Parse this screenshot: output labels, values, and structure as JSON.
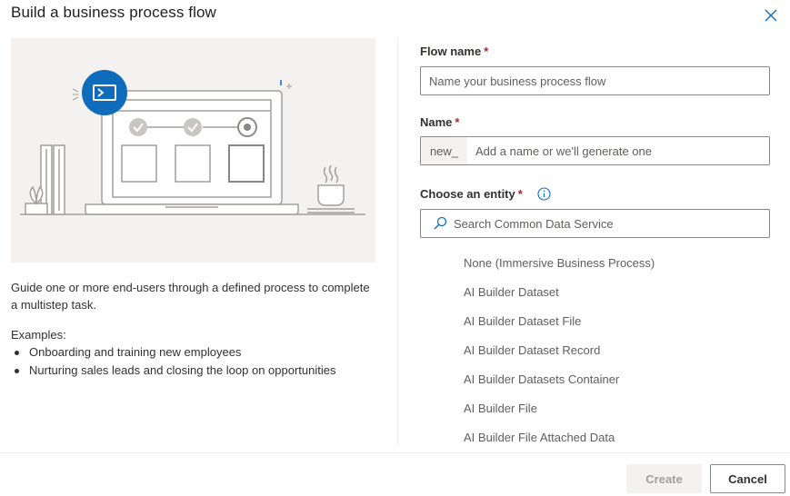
{
  "dialog": {
    "title": "Build a business process flow",
    "close_icon": "close-icon"
  },
  "left": {
    "illustration_icon": "flow-terminal-icon",
    "description": "Guide one or more end-users through a defined process to complete a multistep task.",
    "examples_label": "Examples:",
    "examples": [
      "Onboarding and training new employees",
      "Nurturing sales leads and closing the loop on opportunities"
    ]
  },
  "form": {
    "flow_name": {
      "label": "Flow name",
      "required_marker": "*",
      "placeholder": "Name your business process flow",
      "value": ""
    },
    "name": {
      "label": "Name",
      "required_marker": "*",
      "prefix": "new_",
      "placeholder": "Add a name or we'll generate one",
      "value": ""
    },
    "entity": {
      "label": "Choose an entity",
      "required_marker": "*",
      "info_icon": "info-icon",
      "search_placeholder": "Search Common Data Service",
      "search_value": "",
      "options": [
        "None (Immersive Business Process)",
        "AI Builder Dataset",
        "AI Builder Dataset File",
        "AI Builder Dataset Record",
        "AI Builder Datasets Container",
        "AI Builder File",
        "AI Builder File Attached Data"
      ]
    }
  },
  "footer": {
    "create_label": "Create",
    "cancel_label": "Cancel"
  },
  "colors": {
    "accent": "#0f6cbd",
    "required": "#a4262c",
    "illustration_bg": "#f3f2f1"
  }
}
